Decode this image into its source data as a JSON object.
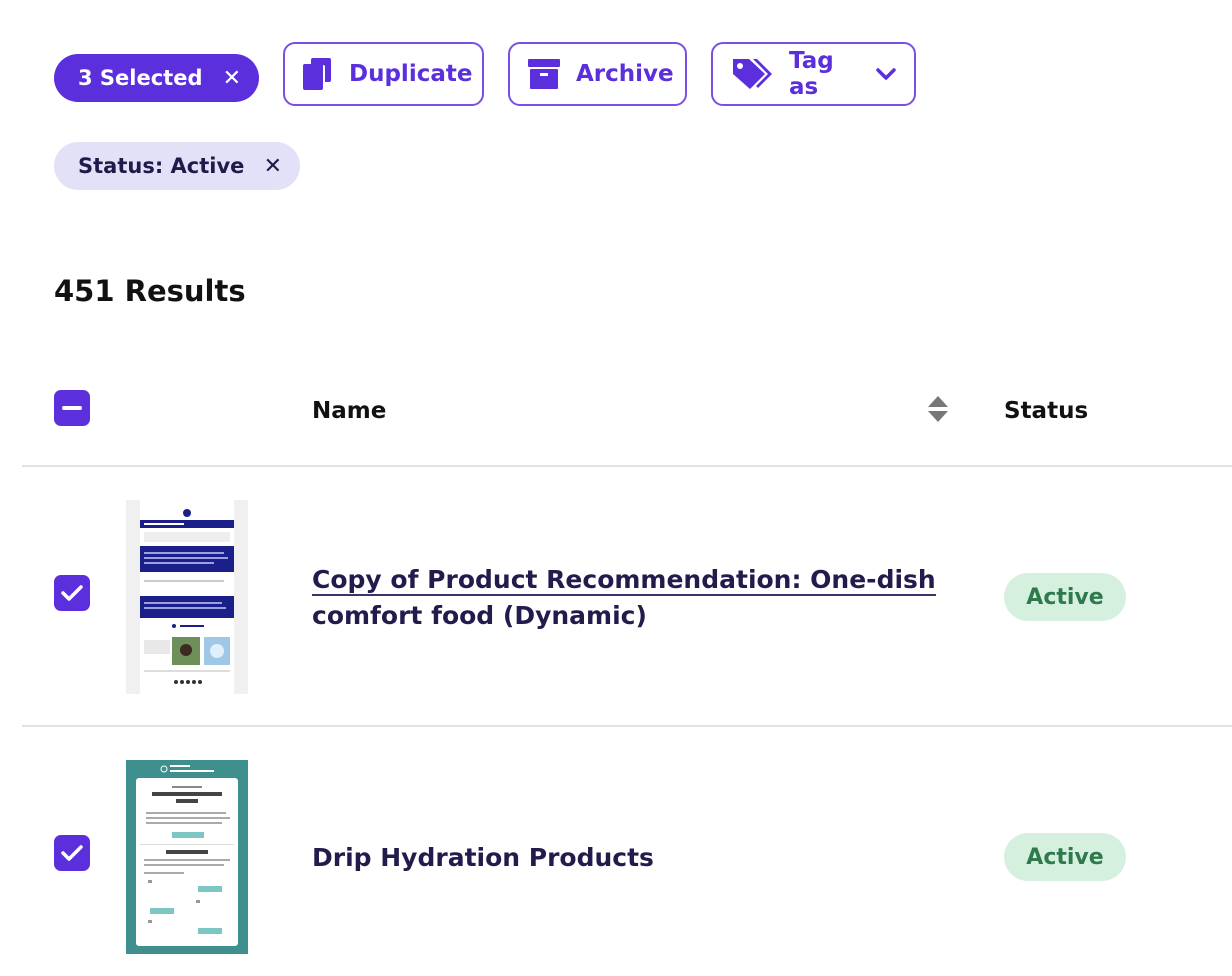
{
  "toolbar": {
    "selected_label": "3 Selected",
    "duplicate_label": "Duplicate",
    "archive_label": "Archive",
    "tag_label": "Tag as"
  },
  "filter": {
    "label": "Status: Active"
  },
  "results_label": "451 Results",
  "table": {
    "col_name": "Name",
    "col_status": "Status",
    "rows": [
      {
        "name_line1": "Copy of Product Recommendation: One-dish",
        "name_line2": "comfort food (Dynamic)",
        "status": "Active",
        "checked": true
      },
      {
        "name_line1": "Drip Hydration Products",
        "status": "Active",
        "checked": true
      }
    ]
  },
  "colors": {
    "accent": "#5b2fdc",
    "chip_bg": "#e3e1f8",
    "badge_bg": "#d6f0e0",
    "badge_text": "#2e7a4c",
    "thumb2_bg": "#3f8f8f"
  }
}
